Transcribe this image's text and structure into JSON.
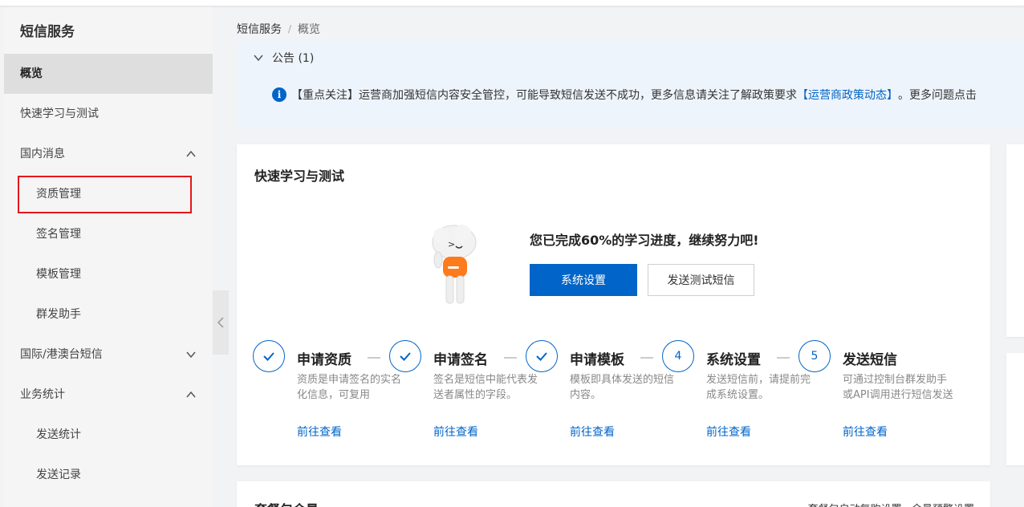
{
  "sidebar": {
    "title": "短信服务",
    "items": [
      {
        "label": "概览"
      },
      {
        "label": "快速学习与测试"
      },
      {
        "label": "国内消息"
      },
      {
        "label": "资质管理"
      },
      {
        "label": "签名管理"
      },
      {
        "label": "模板管理"
      },
      {
        "label": "群发助手"
      },
      {
        "label": "国际/港澳台短信"
      },
      {
        "label": "业务统计"
      },
      {
        "label": "发送统计"
      },
      {
        "label": "发送记录"
      }
    ]
  },
  "breadcrumb": {
    "root": "短信服务",
    "sep": "/",
    "current": "概览"
  },
  "notice": {
    "header": "公告 (1)",
    "text_before": "【重点关注】运营商加强短信内容安全管控，可能导致短信发送不成功，更多信息请关注了解政策要求",
    "link": "【运营商政策动态】",
    "text_after": "。更多问题点击"
  },
  "quick": {
    "title": "快速学习与测试",
    "progress_text": "您已完成60%的学习进度，继续努力吧!",
    "progress_percent": 60,
    "btn_primary": "系统设置",
    "btn_default": "发送测试短信",
    "steps": [
      {
        "status": "done",
        "number": "",
        "title": "申请资质",
        "desc": "资质是申请签名的实名化信息，可复用",
        "link": "前往查看"
      },
      {
        "status": "done",
        "number": "",
        "title": "申请签名",
        "desc": "签名是短信中能代表发送者属性的字段。",
        "link": "前往查看"
      },
      {
        "status": "done",
        "number": "",
        "title": "申请模板",
        "desc": "模板即具体发送的短信内容。",
        "link": "前往查看"
      },
      {
        "status": "todo",
        "number": "4",
        "title": "系统设置",
        "desc": "发送短信前，请提前完成系统设置。",
        "link": "前往查看"
      },
      {
        "status": "todo",
        "number": "5",
        "title": "发送短信",
        "desc": "可通过控制台群发助手或API调用进行短信发送",
        "link": "前往查看"
      }
    ]
  },
  "bottom_card": {
    "title": "套餐包余量",
    "right_text": "套餐包自动复购设置 · 余量预警设置"
  },
  "colors": {
    "primary": "#0064c8",
    "highlight": "#e8161b",
    "notice_bg": "#eef4fb"
  }
}
